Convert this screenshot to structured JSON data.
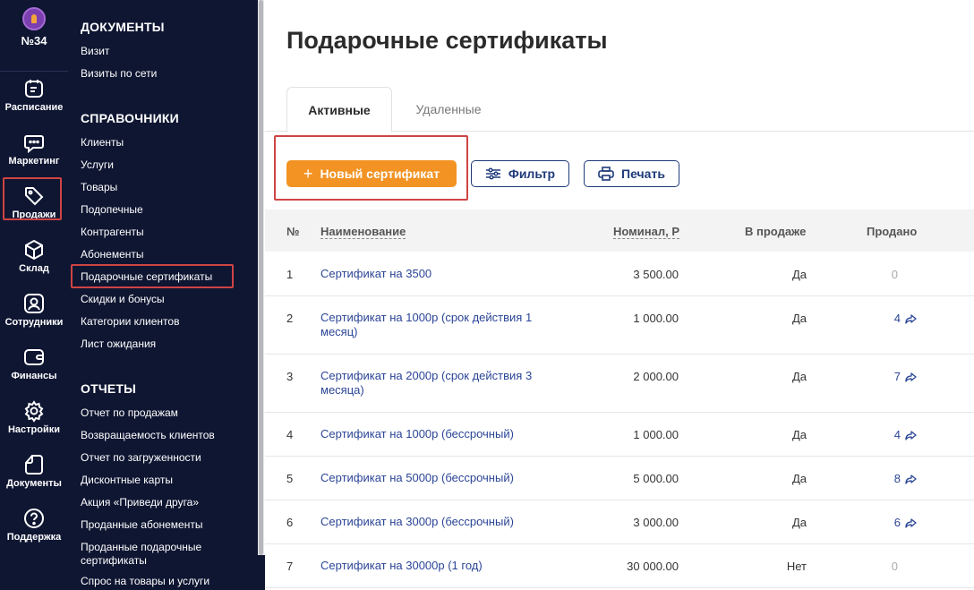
{
  "rail": {
    "org": "№34",
    "items": [
      {
        "label": "Расписание",
        "icon": "calendar-icon"
      },
      {
        "label": "Маркетинг",
        "icon": "chat-icon"
      },
      {
        "label": "Продажи",
        "icon": "tag-icon"
      },
      {
        "label": "Склад",
        "icon": "box-icon"
      },
      {
        "label": "Сотрудники",
        "icon": "user-icon"
      },
      {
        "label": "Финансы",
        "icon": "wallet-icon"
      },
      {
        "label": "Настройки",
        "icon": "gear-icon"
      },
      {
        "label": "Документы",
        "icon": "document-icon"
      },
      {
        "label": "Поддержка",
        "icon": "help-icon"
      }
    ]
  },
  "menu": {
    "sections": [
      {
        "title": "ДОКУМЕНТЫ",
        "items": [
          "Визит",
          "Визиты по сети"
        ]
      },
      {
        "title": "СПРАВОЧНИКИ",
        "items": [
          "Клиенты",
          "Услуги",
          "Товары",
          "Подопечные",
          "Контрагенты",
          "Абонементы",
          "Подарочные сертификаты",
          "Скидки и бонусы",
          "Категории клиентов",
          "Лист ожидания"
        ]
      },
      {
        "title": "ОТЧЕТЫ",
        "items": [
          "Отчет по продажам",
          "Возвращаемость клиентов",
          "Отчет по загруженности",
          "Дисконтные карты",
          "Акция «Приведи друга»",
          "Проданные абонементы",
          "Проданные подарочные сертификаты",
          "Спрос на товары и услуги"
        ]
      }
    ]
  },
  "page": {
    "title": "Подарочные сертификаты",
    "tabs": [
      "Активные",
      "Удаленные"
    ],
    "new_button": "Новый сертификат",
    "filter_button": "Фильтр",
    "print_button": "Печать"
  },
  "table": {
    "columns": [
      "№",
      "Наименование",
      "Номинал, Р",
      "В продаже",
      "Продано"
    ],
    "rows": [
      {
        "n": "1",
        "name": "Сертификат на 3500",
        "nominal": "3 500.00",
        "on_sale": "Да",
        "sold": "0"
      },
      {
        "n": "2",
        "name": "Сертификат на 1000р (срок действия 1 месяц)",
        "nominal": "1 000.00",
        "on_sale": "Да",
        "sold": "4"
      },
      {
        "n": "3",
        "name": "Сертификат на 2000р (срок действия 3 месяца)",
        "nominal": "2 000.00",
        "on_sale": "Да",
        "sold": "7"
      },
      {
        "n": "4",
        "name": "Сертификат на 1000р (бессрочный)",
        "nominal": "1 000.00",
        "on_sale": "Да",
        "sold": "4"
      },
      {
        "n": "5",
        "name": "Сертификат на 5000р (бессрочный)",
        "nominal": "5 000.00",
        "on_sale": "Да",
        "sold": "8"
      },
      {
        "n": "6",
        "name": "Сертификат на 3000р (бессрочный)",
        "nominal": "3 000.00",
        "on_sale": "Да",
        "sold": "6"
      },
      {
        "n": "7",
        "name": "Сертификат на 30000р (1 год)",
        "nominal": "30 000.00",
        "on_sale": "Нет",
        "sold": "0"
      }
    ]
  },
  "colors": {
    "sidebar": "#0f1632",
    "accent": "#f29323",
    "link": "#2b4596",
    "highlight": "#d04444"
  }
}
